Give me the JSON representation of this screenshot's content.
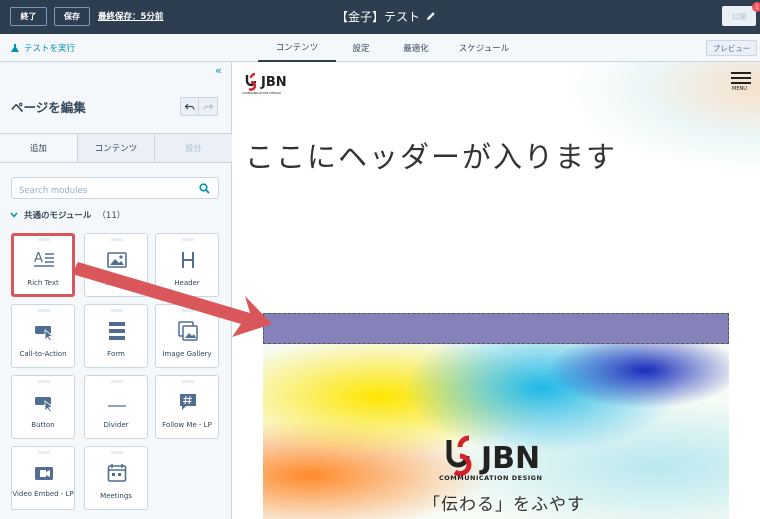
{
  "topbar": {
    "exit_label": "終了",
    "save_label": "保存",
    "last_saved": "最終保存：5分前",
    "page_title": "【金子】テスト",
    "publish_label": "公開",
    "notification_count": "1"
  },
  "subbar": {
    "run_test": "テストを実行",
    "tabs": [
      "コンテンツ",
      "設定",
      "最適化",
      "スケジュール"
    ],
    "active_tab": "コンテンツ",
    "preview_label": "プレビュー"
  },
  "sidebar": {
    "title": "ページを編集",
    "tabs": [
      "追加",
      "コンテンツ",
      "設計"
    ],
    "search_placeholder": "Search modules",
    "section_title": "共通のモジュール",
    "section_count": "（11）",
    "modules": [
      "Rich Text",
      "Image",
      "Header",
      "Call-to-Action",
      "Form",
      "Image Gallery",
      "Button",
      "Divider",
      "Follow Me - LP",
      "Video Embed - LP",
      "Meetings"
    ],
    "highlighted_module": "Rich Text"
  },
  "canvas": {
    "logo_text": "JBN",
    "logo_sub": "COMMUNICATION DESIGN",
    "menu_label": "MENU",
    "header_placeholder": "ここにヘッダーが入ります",
    "hero_logo_text": "JBN",
    "hero_logo_sub": "COMMUNICATION DESIGN",
    "hero_tagline": "「伝わる」をふやす"
  },
  "colors": {
    "topbar_bg": "#2d3e50",
    "accent": "#0091ae",
    "highlight": "#d9575a",
    "drop_zone": "#8482b8"
  }
}
